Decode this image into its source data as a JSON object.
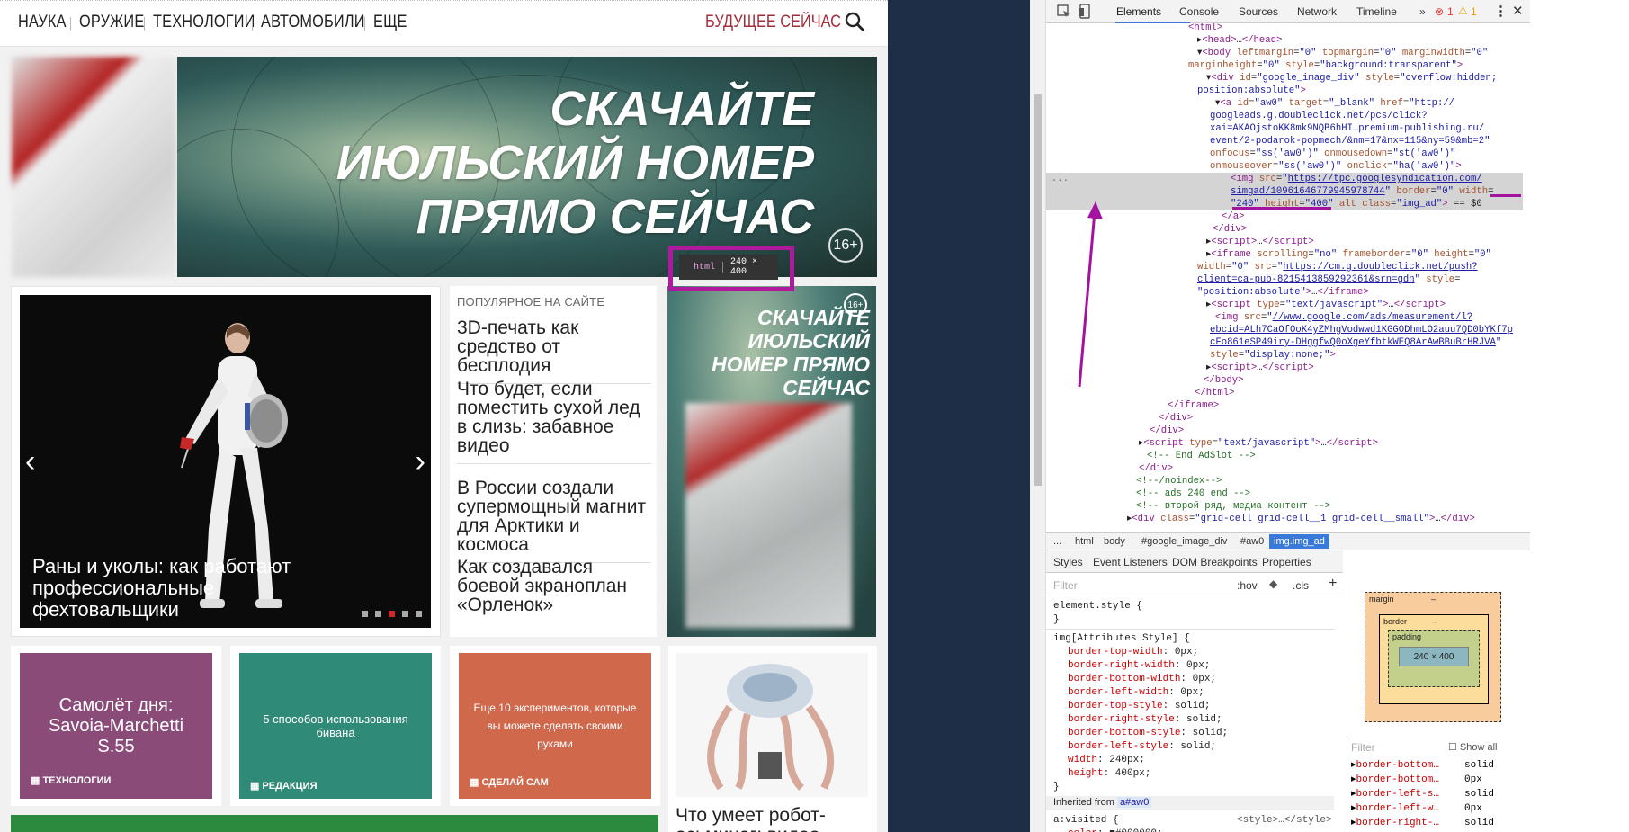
{
  "site": {
    "nav": [
      "НАУКА",
      "ОРУЖИЕ",
      "ТЕХНОЛОГИИ",
      "АВТОМОБИЛИ",
      "ЕЩЕ"
    ],
    "future_link": "БУДУЩЕЕ СЕЙЧАС",
    "banner": {
      "title": "СКАЧАЙТЕ ИЮЛЬСКИЙ НОМЕР ПРЯМО СЕЙЧАС",
      "age": "16+"
    },
    "slider": {
      "caption": "Раны и уколы: как работают профессиональные фехтовальщики",
      "prev": "‹",
      "next": "›",
      "active_dot": 3
    },
    "popular": {
      "heading": "ПОПУЛЯРНОЕ НА САЙТЕ",
      "items": [
        "3D-печать как средство от бесплодия",
        "Что будет, если поместить сухой лед в слизь: забавное видео",
        "В России создали супермощный магнит для Арктики и космоса",
        "Как создавался боевой экраноплан «Орленок»"
      ]
    },
    "ad2": {
      "title": "СКАЧАЙТЕ ИЮЛЬСКИЙ НОМЕР ПРЯМО СЕЙЧАС",
      "age": "16+"
    },
    "inspect_tooltip": {
      "tag": "html",
      "size": "240 × 400"
    },
    "tiles": [
      {
        "title": "Самолёт дня: Savoia-Marchetti S.55",
        "tag": "ТЕХНОЛОГИИ",
        "color": "#8a4b79"
      },
      {
        "title": "5 способов использования бивана",
        "tag": "РЕДАКЦИЯ",
        "color": "#2f8a78"
      },
      {
        "title": "Еще 10 экспериментов, которые вы можете сделать своими руками",
        "tag": "СДЕЛАЙ САМ",
        "color": "#d0684c"
      }
    ],
    "robot_caption": "Что умеет робот-осьминог: видео"
  },
  "devtools": {
    "tabs": [
      "Elements",
      "Console",
      "Sources",
      "Network",
      "Timeline",
      "»"
    ],
    "errors": "1",
    "warnings": "1",
    "breadcrumbs": [
      "...",
      "html",
      "body",
      "#google_image_div",
      "#aw0",
      "img.img_ad"
    ],
    "style_tabs": [
      "Styles",
      "Event Listeners",
      "DOM Breakpoints",
      "Properties"
    ],
    "filter_placeholder": "Filter",
    "hov": ":hov",
    "cls": ".cls",
    "box_model": {
      "margin": "margin",
      "border": "border",
      "padding": "padding",
      "content": "240 × 400",
      "dash": "–"
    },
    "computed": [
      {
        "prop": "border-bottom…",
        "val": "solid"
      },
      {
        "prop": "border-bottom…",
        "val": "0px"
      },
      {
        "prop": "border-left-s…",
        "val": "solid"
      },
      {
        "prop": "border-left-w…",
        "val": "0px"
      },
      {
        "prop": "border-right-…",
        "val": "solid"
      }
    ],
    "show_all": "Show all",
    "filter2": "Filter",
    "inherited": "Inherited from",
    "inherited_target": "a#aw0",
    "style_source": "<style>…</style>"
  }
}
